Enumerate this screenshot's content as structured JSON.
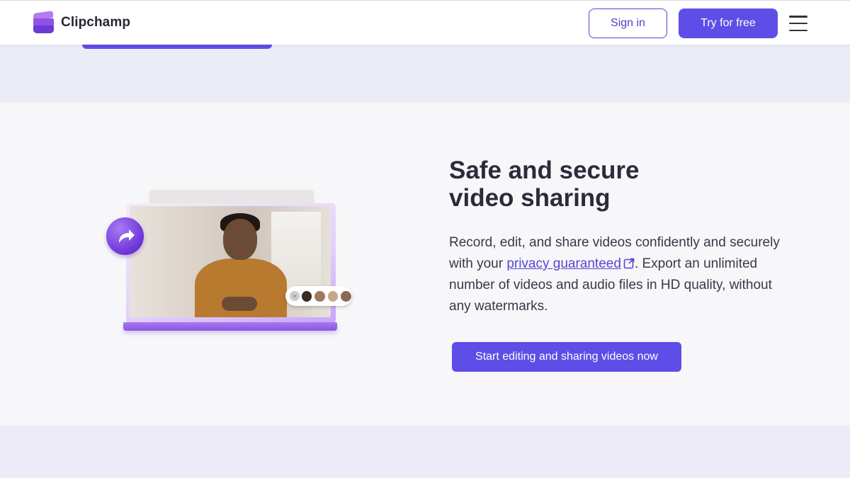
{
  "header": {
    "brand": "Clipchamp",
    "signin_label": "Sign in",
    "try_label": "Try for free"
  },
  "section": {
    "title_line1": "Safe and secure",
    "title_line2": "video sharing",
    "body_before_link": "Record, edit, and share videos confidently and securely with your ",
    "link_text": "privacy guaranteed",
    "body_after_link": ". Export an unlimited number of videos and audio files in HD quality, without any watermarks.",
    "cta_label": "Start editing and sharing videos now"
  },
  "colors": {
    "accent": "#5e4de6",
    "link": "#5446d6",
    "section_bg": "#f7f6f8",
    "band_bg": "#ececf7"
  },
  "icons": [
    "clipchamp-logo-icon",
    "hamburger-menu-icon",
    "external-link-icon",
    "share-arrow-icon"
  ]
}
